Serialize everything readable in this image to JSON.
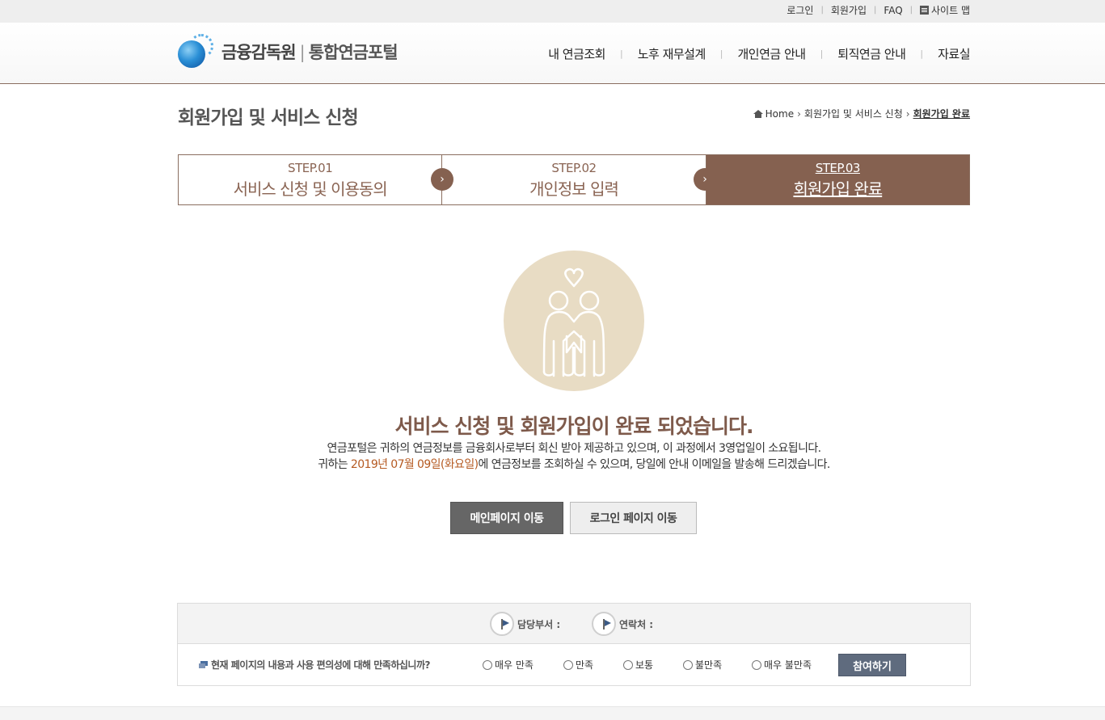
{
  "topbar": {
    "links": [
      "로그인",
      "회원가입",
      "FAQ"
    ],
    "sitemap": "사이트 맵"
  },
  "logo": {
    "org": "금융감독원",
    "divider": "|",
    "service": "통합연금포털",
    "icon": "fss-globe-logo"
  },
  "gnb": {
    "items": [
      "내 연금조회",
      "노후 재무설계",
      "개인연금 안내",
      "퇴직연금 안내",
      "자료실"
    ]
  },
  "page": {
    "title": "회원가입 및 서비스 신청"
  },
  "breadcrumb": {
    "home": "Home",
    "section": "회원가입 및 서비스 신청",
    "current": "회원가입 완료"
  },
  "steps": [
    {
      "num": "STEP.01",
      "label": "서비스 신청 및 이용동의",
      "active": false
    },
    {
      "num": "STEP.02",
      "label": "개인정보 입력",
      "active": false
    },
    {
      "num": "STEP.03",
      "label": "회원가입 완료",
      "active": true
    }
  ],
  "completion": {
    "title": "서비스 신청 및 회원가입이 완료 되었습니다.",
    "line1": "연금포털은 귀하의 연금정보를 금융회사로부터 회신 받아 제공하고 있으며, 이 과정에서 3영업일이 소요됩니다.",
    "line2_prefix": "귀하는 ",
    "line2_date": "2019년 07월 09일(화요일)",
    "line2_suffix": "에 연금정보를 조회하실 수 있으며, 당일에 안내 이메일을 발송해 드리겠습니다."
  },
  "buttons": {
    "main": "메인페이지 이동",
    "login": "로그인 페이지 이동"
  },
  "survey": {
    "dept_label": "담당부서 :",
    "contact_label": "연락처 :",
    "question": "현재 페이지의 내용과 사용 편의성에 대해 만족하십니까?",
    "options": [
      "매우 만족",
      "만족",
      "보통",
      "불만족",
      "매우 불만족"
    ],
    "submit": "참여하기"
  },
  "colors": {
    "brand_brown": "#856150",
    "highlight": "#b55a22",
    "hero_bg": "#e8dcc4"
  }
}
